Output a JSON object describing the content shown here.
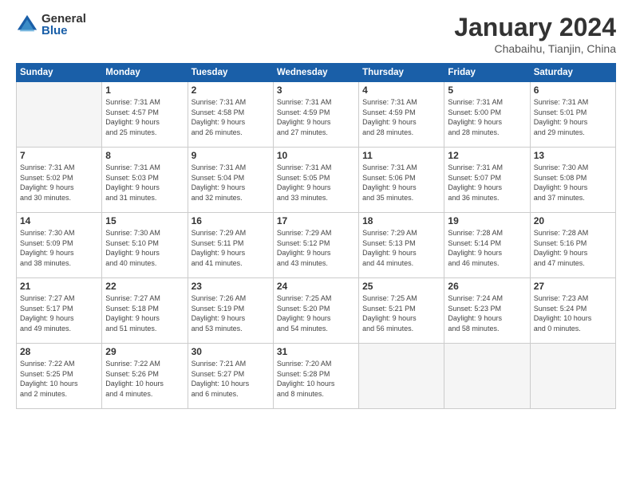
{
  "logo": {
    "general": "General",
    "blue": "Blue"
  },
  "header": {
    "month_title": "January 2024",
    "location": "Chabaihu, Tianjin, China"
  },
  "days_of_week": [
    "Sunday",
    "Monday",
    "Tuesday",
    "Wednesday",
    "Thursday",
    "Friday",
    "Saturday"
  ],
  "weeks": [
    [
      {
        "day": "",
        "info": ""
      },
      {
        "day": "1",
        "info": "Sunrise: 7:31 AM\nSunset: 4:57 PM\nDaylight: 9 hours\nand 25 minutes."
      },
      {
        "day": "2",
        "info": "Sunrise: 7:31 AM\nSunset: 4:58 PM\nDaylight: 9 hours\nand 26 minutes."
      },
      {
        "day": "3",
        "info": "Sunrise: 7:31 AM\nSunset: 4:59 PM\nDaylight: 9 hours\nand 27 minutes."
      },
      {
        "day": "4",
        "info": "Sunrise: 7:31 AM\nSunset: 4:59 PM\nDaylight: 9 hours\nand 28 minutes."
      },
      {
        "day": "5",
        "info": "Sunrise: 7:31 AM\nSunset: 5:00 PM\nDaylight: 9 hours\nand 28 minutes."
      },
      {
        "day": "6",
        "info": "Sunrise: 7:31 AM\nSunset: 5:01 PM\nDaylight: 9 hours\nand 29 minutes."
      }
    ],
    [
      {
        "day": "7",
        "info": "Sunrise: 7:31 AM\nSunset: 5:02 PM\nDaylight: 9 hours\nand 30 minutes."
      },
      {
        "day": "8",
        "info": "Sunrise: 7:31 AM\nSunset: 5:03 PM\nDaylight: 9 hours\nand 31 minutes."
      },
      {
        "day": "9",
        "info": "Sunrise: 7:31 AM\nSunset: 5:04 PM\nDaylight: 9 hours\nand 32 minutes."
      },
      {
        "day": "10",
        "info": "Sunrise: 7:31 AM\nSunset: 5:05 PM\nDaylight: 9 hours\nand 33 minutes."
      },
      {
        "day": "11",
        "info": "Sunrise: 7:31 AM\nSunset: 5:06 PM\nDaylight: 9 hours\nand 35 minutes."
      },
      {
        "day": "12",
        "info": "Sunrise: 7:31 AM\nSunset: 5:07 PM\nDaylight: 9 hours\nand 36 minutes."
      },
      {
        "day": "13",
        "info": "Sunrise: 7:30 AM\nSunset: 5:08 PM\nDaylight: 9 hours\nand 37 minutes."
      }
    ],
    [
      {
        "day": "14",
        "info": "Sunrise: 7:30 AM\nSunset: 5:09 PM\nDaylight: 9 hours\nand 38 minutes."
      },
      {
        "day": "15",
        "info": "Sunrise: 7:30 AM\nSunset: 5:10 PM\nDaylight: 9 hours\nand 40 minutes."
      },
      {
        "day": "16",
        "info": "Sunrise: 7:29 AM\nSunset: 5:11 PM\nDaylight: 9 hours\nand 41 minutes."
      },
      {
        "day": "17",
        "info": "Sunrise: 7:29 AM\nSunset: 5:12 PM\nDaylight: 9 hours\nand 43 minutes."
      },
      {
        "day": "18",
        "info": "Sunrise: 7:29 AM\nSunset: 5:13 PM\nDaylight: 9 hours\nand 44 minutes."
      },
      {
        "day": "19",
        "info": "Sunrise: 7:28 AM\nSunset: 5:14 PM\nDaylight: 9 hours\nand 46 minutes."
      },
      {
        "day": "20",
        "info": "Sunrise: 7:28 AM\nSunset: 5:16 PM\nDaylight: 9 hours\nand 47 minutes."
      }
    ],
    [
      {
        "day": "21",
        "info": "Sunrise: 7:27 AM\nSunset: 5:17 PM\nDaylight: 9 hours\nand 49 minutes."
      },
      {
        "day": "22",
        "info": "Sunrise: 7:27 AM\nSunset: 5:18 PM\nDaylight: 9 hours\nand 51 minutes."
      },
      {
        "day": "23",
        "info": "Sunrise: 7:26 AM\nSunset: 5:19 PM\nDaylight: 9 hours\nand 53 minutes."
      },
      {
        "day": "24",
        "info": "Sunrise: 7:25 AM\nSunset: 5:20 PM\nDaylight: 9 hours\nand 54 minutes."
      },
      {
        "day": "25",
        "info": "Sunrise: 7:25 AM\nSunset: 5:21 PM\nDaylight: 9 hours\nand 56 minutes."
      },
      {
        "day": "26",
        "info": "Sunrise: 7:24 AM\nSunset: 5:23 PM\nDaylight: 9 hours\nand 58 minutes."
      },
      {
        "day": "27",
        "info": "Sunrise: 7:23 AM\nSunset: 5:24 PM\nDaylight: 10 hours\nand 0 minutes."
      }
    ],
    [
      {
        "day": "28",
        "info": "Sunrise: 7:22 AM\nSunset: 5:25 PM\nDaylight: 10 hours\nand 2 minutes."
      },
      {
        "day": "29",
        "info": "Sunrise: 7:22 AM\nSunset: 5:26 PM\nDaylight: 10 hours\nand 4 minutes."
      },
      {
        "day": "30",
        "info": "Sunrise: 7:21 AM\nSunset: 5:27 PM\nDaylight: 10 hours\nand 6 minutes."
      },
      {
        "day": "31",
        "info": "Sunrise: 7:20 AM\nSunset: 5:28 PM\nDaylight: 10 hours\nand 8 minutes."
      },
      {
        "day": "",
        "info": ""
      },
      {
        "day": "",
        "info": ""
      },
      {
        "day": "",
        "info": ""
      }
    ]
  ]
}
